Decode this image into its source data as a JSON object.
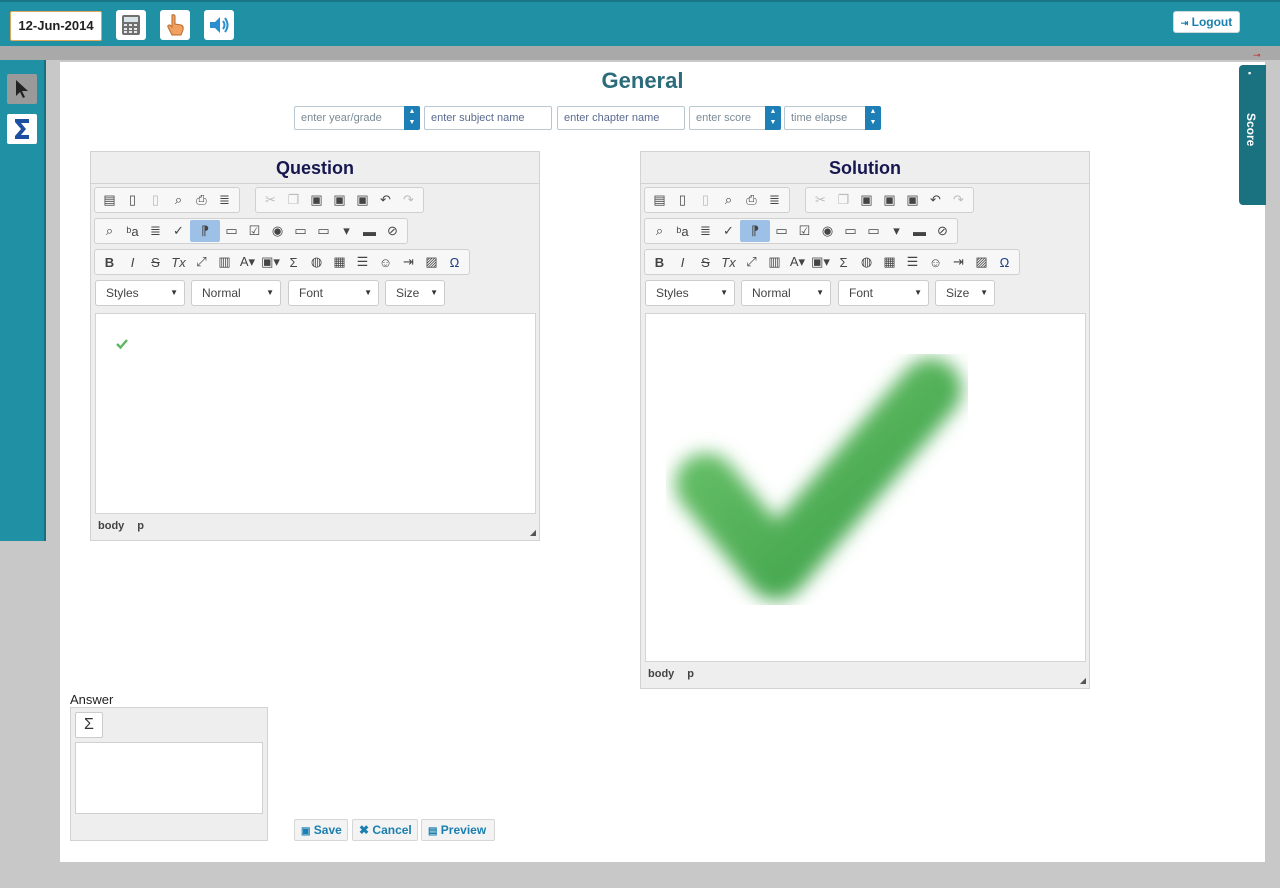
{
  "topbar": {
    "date": "12-Jun-2014",
    "icons": [
      "calculator-icon",
      "hand-pointer-icon",
      "speaker-icon"
    ],
    "logout_label": "Logout"
  },
  "sidebar": {
    "tools": [
      "cursor-arrow-icon",
      "sigma-icon"
    ]
  },
  "page": {
    "title": "General",
    "filters": {
      "year_placeholder": "enter year/grade",
      "subject_placeholder": "enter subject name",
      "chapter_placeholder": "enter chapter name",
      "score_placeholder": "enter score",
      "time_placeholder": "time elapse"
    }
  },
  "question": {
    "title": "Question",
    "combos": {
      "styles": "Styles",
      "format": "Normal",
      "font": "Font",
      "size": "Size"
    },
    "path": [
      "body",
      "p"
    ]
  },
  "solution": {
    "title": "Solution",
    "combos": {
      "styles": "Styles",
      "format": "Normal",
      "font": "Font",
      "size": "Size"
    },
    "path": [
      "body",
      "p"
    ]
  },
  "answer": {
    "label": "Answer"
  },
  "actions": {
    "save": "Save",
    "cancel": "Cancel",
    "preview": "Preview"
  },
  "score_tab": {
    "label": "Score"
  },
  "colors": {
    "teal": "#2090a4",
    "title": "#2b6b7a",
    "link": "#1a7fb0",
    "check_green": "#5cb85c"
  }
}
